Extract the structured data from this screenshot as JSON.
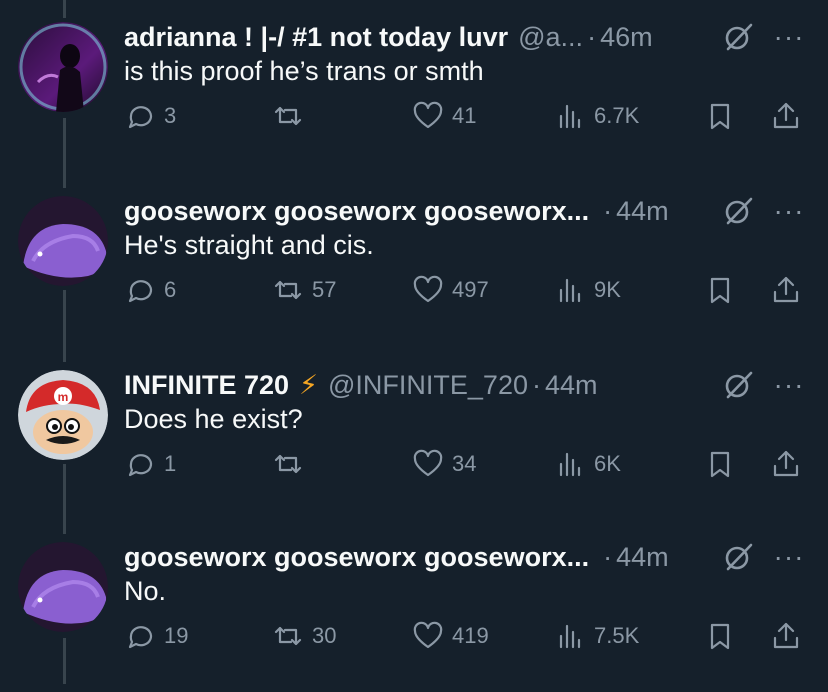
{
  "tweets": [
    {
      "name": "adrianna ! |-/ #1 not today luvr",
      "handle": "@a...",
      "bolt": "",
      "time": "46m",
      "text": "is this proof he’s trans or smth",
      "replies": "3",
      "reposts": "",
      "likes": "41",
      "views": "6.7K",
      "avatar": "dark-purple-profile-photo"
    },
    {
      "name": "gooseworx gooseworx gooseworx...",
      "handle": "",
      "bolt": "",
      "time": "44m",
      "text": "He's straight and cis.",
      "replies": "6",
      "reposts": "57",
      "likes": "497",
      "views": "9K",
      "avatar": "purple-creature-avatar"
    },
    {
      "name": "INFINITE 720",
      "handle": "@INFINITE_720",
      "bolt": "⚡",
      "time": "44m",
      "text": "Does he exist?",
      "replies": "1",
      "reposts": "",
      "likes": "34",
      "views": "6K",
      "avatar": "cartoon-plumber-avatar"
    },
    {
      "name": "gooseworx gooseworx gooseworx...",
      "handle": "",
      "bolt": "",
      "time": "44m",
      "text": "No.",
      "replies": "19",
      "reposts": "30",
      "likes": "419",
      "views": "7.5K",
      "avatar": "purple-creature-avatar"
    }
  ],
  "separator": "·",
  "more_label": "···",
  "colors": {
    "background": "#15202b",
    "primary_text": "#f7f9f9",
    "secondary_text": "#8b98a5",
    "thread_line": "#38444d",
    "bolt": "#f5a623"
  },
  "icons": [
    "reply-icon",
    "repost-icon",
    "like-icon",
    "views-icon",
    "bookmark-icon",
    "share-icon",
    "grok-icon",
    "more-icon"
  ]
}
